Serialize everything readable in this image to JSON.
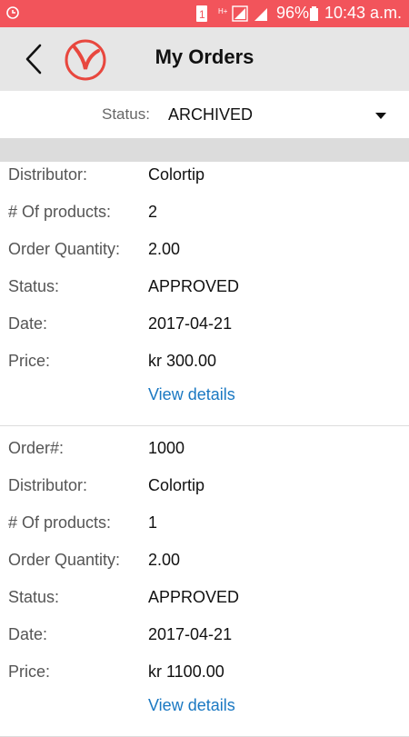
{
  "statusbar": {
    "left_icon": "app-notification-icon",
    "indicator": "1",
    "network": "H+",
    "battery_pct": "96%",
    "time": "10:43 a.m."
  },
  "header": {
    "title": "My Orders",
    "back_icon": "chevron-left-icon",
    "logo_icon": "brand-logo-v-icon"
  },
  "filter": {
    "label": "Status:",
    "value": "ARCHIVED"
  },
  "orders": [
    {
      "fields": [
        {
          "label": "Distributor:",
          "value": "Colortip"
        },
        {
          "label": "# Of products:",
          "value": "2"
        },
        {
          "label": "Order Quantity:",
          "value": "2.00"
        },
        {
          "label": "Status:",
          "value": "APPROVED"
        },
        {
          "label": "Date:",
          "value": "2017-04-21"
        },
        {
          "label": "Price:",
          "value": "kr 300.00"
        }
      ],
      "link": "View details"
    },
    {
      "fields": [
        {
          "label": "Order#:",
          "value": "1000"
        },
        {
          "label": "Distributor:",
          "value": "Colortip"
        },
        {
          "label": "# Of products:",
          "value": "1"
        },
        {
          "label": "Order Quantity:",
          "value": "2.00"
        },
        {
          "label": "Status:",
          "value": "APPROVED"
        },
        {
          "label": "Date:",
          "value": "2017-04-21"
        },
        {
          "label": "Price:",
          "value": "kr 1100.00"
        }
      ],
      "link": "View details"
    }
  ],
  "colors": {
    "statusbar": "#f2545b",
    "appbar": "#e6e6e6",
    "link": "#1a78c2",
    "brand": "#e8473e"
  }
}
